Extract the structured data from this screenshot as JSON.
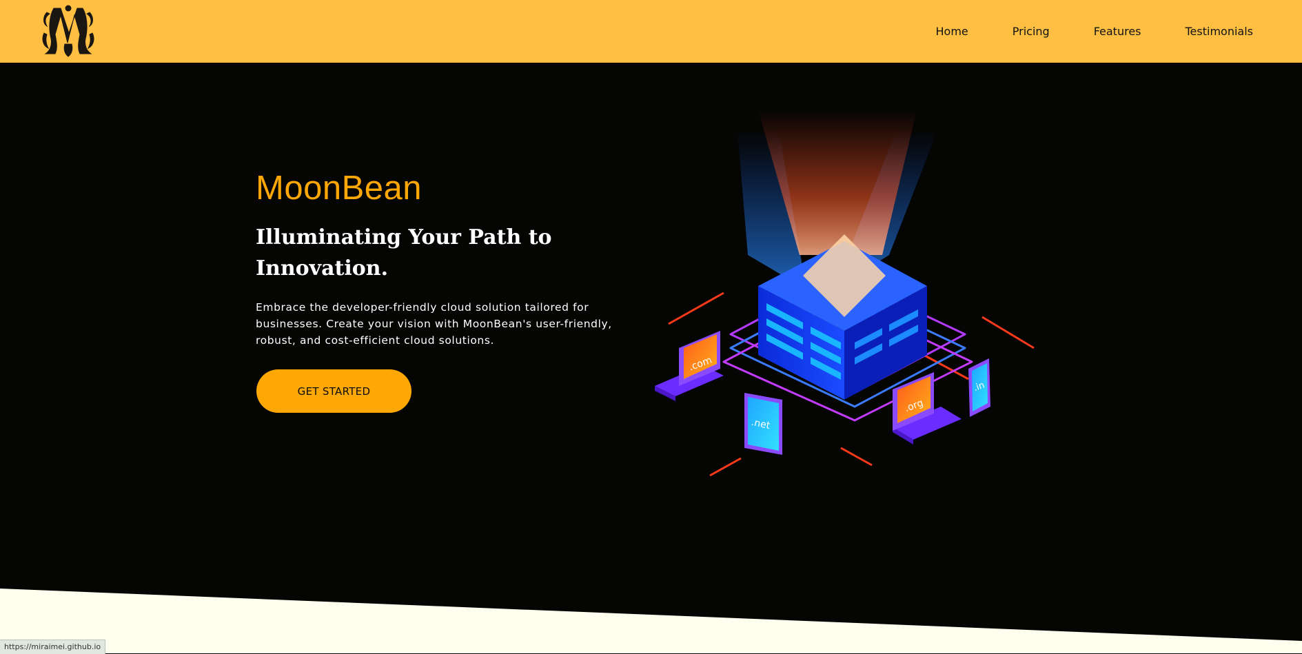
{
  "nav": {
    "links": [
      "Home",
      "Pricing",
      "Features",
      "Testimonials"
    ]
  },
  "hero": {
    "brand": "MoonBean",
    "headline": "Illuminating Your Path to Innovation.",
    "description": "Embrace the developer-friendly cloud solution tailored for businesses. Create your vision with MoonBean's user-friendly, robust, and cost-efficient cloud solutions.",
    "cta_label": "GET STARTED",
    "illustration": {
      "domains": [
        ".com",
        ".net",
        ".org",
        ".in"
      ]
    }
  },
  "status_bar": {
    "url": "https://miraimei.github.io"
  },
  "colors": {
    "nav_bg": "#ffbf43",
    "hero_bg": "#050504",
    "accent": "#ffa705",
    "section_bg": "#fffff0"
  }
}
